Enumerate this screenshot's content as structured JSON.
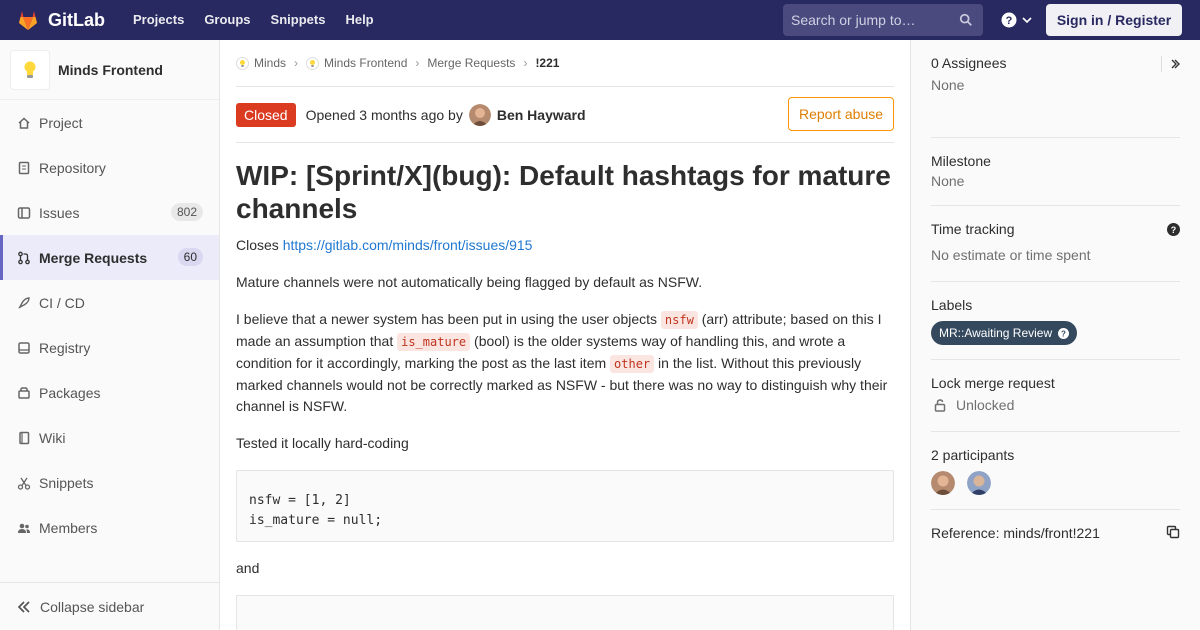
{
  "navbar": {
    "logo_text": "GitLab",
    "links": [
      "Projects",
      "Groups",
      "Snippets",
      "Help"
    ],
    "search_placeholder": "Search or jump to…",
    "signin_label": "Sign in / Register"
  },
  "sidebar": {
    "project_name": "Minds Frontend",
    "items": [
      {
        "label": "Project",
        "icon": "home-icon"
      },
      {
        "label": "Repository",
        "icon": "doc-icon"
      },
      {
        "label": "Issues",
        "icon": "issues-icon",
        "badge": "802"
      },
      {
        "label": "Merge Requests",
        "icon": "merge-icon",
        "badge": "60",
        "active": true
      },
      {
        "label": "CI / CD",
        "icon": "rocket-icon"
      },
      {
        "label": "Registry",
        "icon": "disk-icon"
      },
      {
        "label": "Packages",
        "icon": "package-icon"
      },
      {
        "label": "Wiki",
        "icon": "book-icon"
      },
      {
        "label": "Snippets",
        "icon": "scissors-icon"
      },
      {
        "label": "Members",
        "icon": "users-icon"
      }
    ],
    "collapse_label": "Collapse sidebar"
  },
  "breadcrumb": {
    "items": [
      "Minds",
      "Minds Frontend",
      "Merge Requests"
    ],
    "current": "!221"
  },
  "mr": {
    "status": "Closed",
    "opened": "Opened 3 months ago by",
    "author": "Ben Hayward",
    "report_label": "Report abuse",
    "title": "WIP: [Sprint/X](bug): Default hashtags for mature channels",
    "closes_prefix": "Closes ",
    "closes_link": "https://gitlab.com/minds/front/issues/915",
    "para1": "Mature channels were not automatically being flagged by default as NSFW.",
    "para2_a": "I believe that a newer system has been put in using the user objects ",
    "para2_code1": "nsfw",
    "para2_b": " (arr) attribute; based on this I made an assumption that ",
    "para2_code2": "is_mature",
    "para2_c": " (bool) is the older systems way of handling this, and wrote a condition for it accordingly, marking the post as the last item ",
    "para2_code3": "other",
    "para2_d": " in the list. Without this previously marked channels would not be correctly marked as NSFW - but there was no way to distinguish why their channel is NSFW.",
    "para3": "Tested it locally hard-coding",
    "code_block": "nsfw = [1, 2]\nis_mature = null;",
    "para4": "and"
  },
  "right": {
    "assignees_label": "0 Assignees",
    "assignees_value": "None",
    "milestone_label": "Milestone",
    "milestone_value": "None",
    "time_label": "Time tracking",
    "time_value": "No estimate or time spent",
    "labels_label": "Labels",
    "label_pill": "MR::Awaiting Review",
    "lock_label": "Lock merge request",
    "lock_value": "Unlocked",
    "participants_label": "2 participants",
    "reference": "Reference: minds/front!221"
  },
  "colors": {
    "navbar": "#292961",
    "closed": "#db3b21",
    "report": "#fc9403",
    "link": "#1f78d1",
    "label_pill": "#34495e"
  }
}
